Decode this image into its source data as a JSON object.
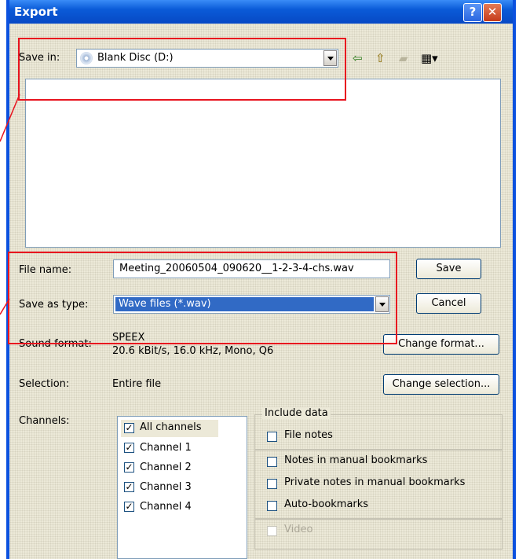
{
  "window": {
    "title": "Export",
    "help": "?",
    "close": "✕"
  },
  "save_in": {
    "label": "Save in:",
    "value": "Blank Disc (D:)"
  },
  "toolbar": {
    "back": "⇦",
    "up": "⇧",
    "newfolder": "▰",
    "views": "▦▾"
  },
  "file_name": {
    "label": "File name:",
    "value": "Meeting_20060504_090620__1-2-3-4-chs.wav"
  },
  "save_as_type": {
    "label": "Save as type:",
    "value": "Wave files (*.wav)"
  },
  "buttons": {
    "save": "Save",
    "cancel": "Cancel",
    "change_format": "Change format...",
    "change_selection": "Change selection..."
  },
  "sound_format": {
    "label": "Sound format:",
    "line1": "SPEEX",
    "line2": "20.6 kBit/s, 16.0 kHz, Mono, Q6"
  },
  "selection": {
    "label": "Selection:",
    "value": "Entire file"
  },
  "channels": {
    "label": "Channels:",
    "items": [
      {
        "label": "All channels",
        "checked": true
      },
      {
        "label": "Channel 1",
        "checked": true
      },
      {
        "label": "Channel 2",
        "checked": true
      },
      {
        "label": "Channel 3",
        "checked": true
      },
      {
        "label": "Channel 4",
        "checked": true
      }
    ]
  },
  "include_data": {
    "label": "Include data",
    "file_notes": "File notes",
    "notes_manual": "Notes in manual bookmarks",
    "private_notes": "Private notes in manual bookmarks",
    "auto_bookmarks": "Auto-bookmarks",
    "video": "Video"
  },
  "colors": {
    "titlebar": "#0a5bd8",
    "highlight": "#316ac5",
    "annotation": "#e8141f"
  }
}
